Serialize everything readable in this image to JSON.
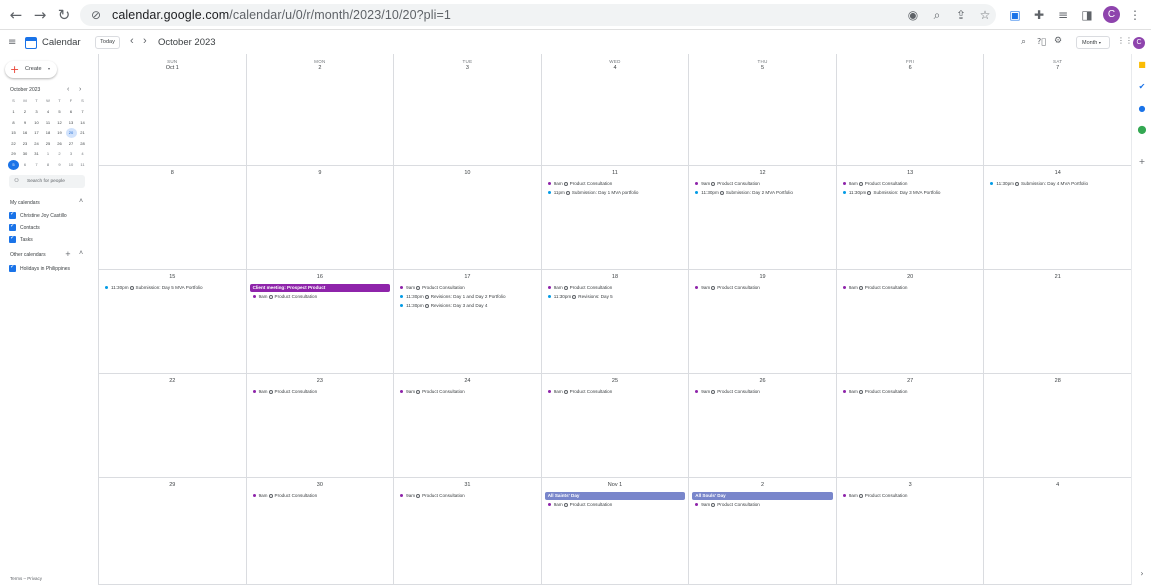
{
  "browser": {
    "url_host": "calendar.google.com",
    "url_path": "/calendar/u/0/r/month/2023/10/20?pli=1",
    "profile_initial": "C"
  },
  "header": {
    "app_name": "Calendar",
    "today_label": "Today",
    "prev": "‹",
    "next": "›",
    "title": "October 2023",
    "view_label": "Month",
    "avatar_initial": "C"
  },
  "sidebar": {
    "create_label": "Create",
    "mini_title": "October 2023",
    "mini_dow": [
      "S",
      "M",
      "T",
      "W",
      "T",
      "F",
      "S"
    ],
    "mini_weeks": [
      [
        "1",
        "2",
        "3",
        "4",
        "5",
        "6",
        "7"
      ],
      [
        "8",
        "9",
        "10",
        "11",
        "12",
        "13",
        "14"
      ],
      [
        "15",
        "16",
        "17",
        "18",
        "19",
        "20",
        "21"
      ],
      [
        "22",
        "23",
        "24",
        "25",
        "26",
        "27",
        "28"
      ],
      [
        "29",
        "30",
        "31",
        "1",
        "2",
        "3",
        "4"
      ],
      [
        "5",
        "6",
        "7",
        "8",
        "9",
        "10",
        "11"
      ]
    ],
    "search_placeholder": "Search for people",
    "my_calendars_label": "My calendars",
    "my_calendars": [
      {
        "name": "Christine Joy Castillo",
        "color": "#1a73e8"
      },
      {
        "name": "Contacts",
        "color": "#1a73e8"
      },
      {
        "name": "Tasks",
        "color": "#1a73e8"
      }
    ],
    "other_calendars_label": "Other calendars",
    "other_calendars": [
      {
        "name": "Holidays in Philippines",
        "color": "#1a73e8"
      }
    ],
    "footer": "Terms – Privacy"
  },
  "calendar": {
    "dow": [
      "SUN",
      "MON",
      "TUE",
      "WED",
      "THU",
      "FRI",
      "SAT"
    ],
    "weeks": [
      [
        {
          "label": "Oct 1",
          "events": []
        },
        {
          "label": "2",
          "events": []
        },
        {
          "label": "3",
          "events": []
        },
        {
          "label": "4",
          "events": []
        },
        {
          "label": "5",
          "events": []
        },
        {
          "label": "6",
          "events": []
        },
        {
          "label": "7",
          "events": []
        }
      ],
      [
        {
          "label": "8",
          "events": []
        },
        {
          "label": "9",
          "events": []
        },
        {
          "label": "10",
          "events": []
        },
        {
          "label": "11",
          "events": [
            {
              "time": "9am",
              "title": "Product Consultation",
              "color": "#8e24aa",
              "kind": "dot"
            },
            {
              "time": "11pm",
              "title": "Submission: Day 1 MVA portfolio",
              "color": "#039be5",
              "kind": "task"
            }
          ]
        },
        {
          "label": "12",
          "events": [
            {
              "time": "9am",
              "title": "Product Consultation",
              "color": "#8e24aa",
              "kind": "dot"
            },
            {
              "time": "11:30pm",
              "title": "Submission: Day 2 MVA Portfolio",
              "color": "#039be5",
              "kind": "task"
            }
          ]
        },
        {
          "label": "13",
          "events": [
            {
              "time": "9am",
              "title": "Product Consultation",
              "color": "#8e24aa",
              "kind": "dot"
            },
            {
              "time": "11:30pm",
              "title": "Submission: Day 3 MVA Portfolio",
              "color": "#039be5",
              "kind": "task"
            }
          ]
        },
        {
          "label": "14",
          "events": [
            {
              "time": "11:30pm",
              "title": "Submission: Day 4 MVA Portfolio",
              "color": "#039be5",
              "kind": "task"
            }
          ]
        }
      ],
      [
        {
          "label": "15",
          "events": [
            {
              "time": "11:30pm",
              "title": "Submission: Day 5 MVA Portfolio",
              "color": "#039be5",
              "kind": "task"
            }
          ]
        },
        {
          "label": "16",
          "events": [
            {
              "time": "",
              "title": "Client meeting: Prospect Product",
              "color": "#8e24aa",
              "kind": "bar"
            },
            {
              "time": "9am",
              "title": "Product Consultation",
              "color": "#8e24aa",
              "kind": "dot"
            }
          ]
        },
        {
          "label": "17",
          "events": [
            {
              "time": "9am",
              "title": "Product Consultation",
              "color": "#8e24aa",
              "kind": "dot"
            },
            {
              "time": "11:30pm",
              "title": "Revisions: Day 1 and Day 2 Portfolio",
              "color": "#039be5",
              "kind": "task"
            },
            {
              "time": "11:30pm",
              "title": "Revisions: Day 3 and Day 4",
              "color": "#039be5",
              "kind": "task"
            }
          ]
        },
        {
          "label": "18",
          "events": [
            {
              "time": "9am",
              "title": "Product Consultation",
              "color": "#8e24aa",
              "kind": "dot"
            },
            {
              "time": "11:30pm",
              "title": "Revisions: Day 5",
              "color": "#039be5",
              "kind": "task"
            }
          ]
        },
        {
          "label": "19",
          "events": [
            {
              "time": "9am",
              "title": "Product Consultation",
              "color": "#8e24aa",
              "kind": "dot"
            }
          ]
        },
        {
          "label": "20",
          "events": [
            {
              "time": "9am",
              "title": "Product Consultation",
              "color": "#8e24aa",
              "kind": "dot"
            }
          ]
        },
        {
          "label": "21",
          "events": []
        }
      ],
      [
        {
          "label": "22",
          "events": []
        },
        {
          "label": "23",
          "events": [
            {
              "time": "9am",
              "title": "Product Consultation",
              "color": "#8e24aa",
              "kind": "dot"
            }
          ]
        },
        {
          "label": "24",
          "events": [
            {
              "time": "9am",
              "title": "Product Consultation",
              "color": "#8e24aa",
              "kind": "dot"
            }
          ]
        },
        {
          "label": "25",
          "events": [
            {
              "time": "9am",
              "title": "Product Consultation",
              "color": "#8e24aa",
              "kind": "dot"
            }
          ]
        },
        {
          "label": "26",
          "events": [
            {
              "time": "9am",
              "title": "Product Consultation",
              "color": "#8e24aa",
              "kind": "dot"
            }
          ]
        },
        {
          "label": "27",
          "events": [
            {
              "time": "9am",
              "title": "Product Consultation",
              "color": "#8e24aa",
              "kind": "dot"
            }
          ]
        },
        {
          "label": "28",
          "events": []
        }
      ],
      [
        {
          "label": "29",
          "events": []
        },
        {
          "label": "30",
          "events": [
            {
              "time": "9am",
              "title": "Product Consultation",
              "color": "#8e24aa",
              "kind": "dot"
            }
          ]
        },
        {
          "label": "31",
          "events": [
            {
              "time": "9am",
              "title": "Product Consultation",
              "color": "#8e24aa",
              "kind": "dot"
            }
          ]
        },
        {
          "label": "Nov 1",
          "events": [
            {
              "time": "",
              "title": "All Saints' Day",
              "color": "#7986cb",
              "kind": "bar"
            },
            {
              "time": "9am",
              "title": "Product Consultation",
              "color": "#8e24aa",
              "kind": "dot"
            }
          ]
        },
        {
          "label": "2",
          "events": [
            {
              "time": "",
              "title": "All Souls' Day",
              "color": "#7986cb",
              "kind": "bar"
            },
            {
              "time": "9am",
              "title": "Product Consultation",
              "color": "#8e24aa",
              "kind": "dot"
            }
          ]
        },
        {
          "label": "3",
          "events": [
            {
              "time": "9am",
              "title": "Product Consultation",
              "color": "#8e24aa",
              "kind": "dot"
            }
          ]
        },
        {
          "label": "4",
          "events": []
        }
      ]
    ]
  },
  "colors": {
    "accent": "#1a73e8",
    "event_purple": "#8e24aa",
    "task_blue": "#039be5",
    "holiday": "#7986cb"
  }
}
